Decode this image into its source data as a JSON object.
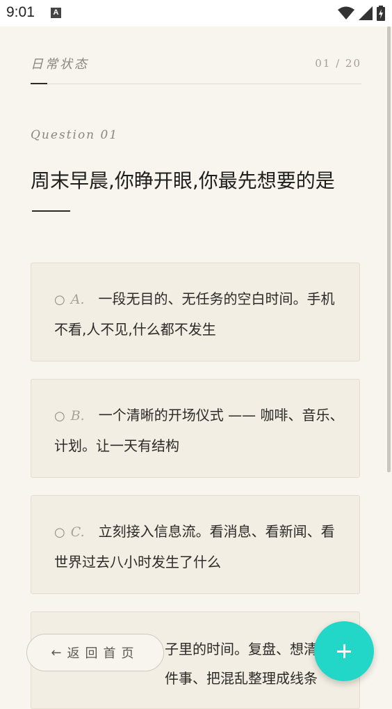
{
  "status": {
    "time": "9:01",
    "notification_icon": "a-icon"
  },
  "header": {
    "label": "日常状态",
    "counter": "01 / 20"
  },
  "question": {
    "label": "Question 01",
    "text": "周末早晨,你睁开眼,你最先想要的是"
  },
  "options": [
    {
      "radio": "○",
      "letter": "A.",
      "text": "一段无目的、无任务的空白时间。手机不看,人不见,什么都不发生"
    },
    {
      "radio": "○",
      "letter": "B.",
      "text": "一个清晰的开场仪式 —— 咖啡、音乐、计划。让一天有结构"
    },
    {
      "radio": "○",
      "letter": "C.",
      "text": "立刻接入信息流。看消息、看新闻、看世界过去八小时发生了什么"
    },
    {
      "radio": "",
      "letter": "",
      "text": "子里的时间。复盘、想清楚某件事、把混乱整理成线条"
    }
  ],
  "footer": {
    "home_label": "返回首页",
    "arrow_icon": "←"
  },
  "colors": {
    "accent": "#22d6c8",
    "background": "#f8f5ef",
    "card": "#f2eee3"
  }
}
